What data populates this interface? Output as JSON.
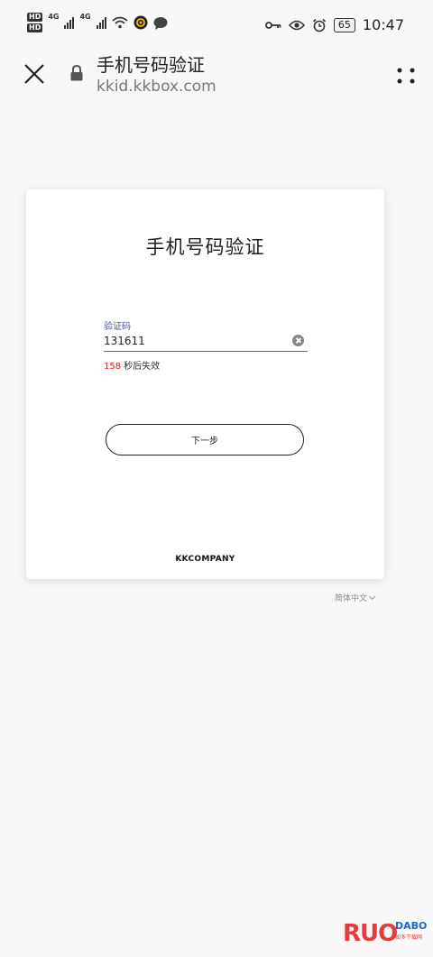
{
  "status_bar": {
    "network_tags": [
      "HD",
      "HD"
    ],
    "signal_labels": [
      "4G",
      "4G"
    ],
    "battery": "65",
    "time": "10:47",
    "icons": [
      "signal-icon",
      "wifi-icon",
      "accessibility-icon",
      "chat-icon",
      "key-icon",
      "eye-icon",
      "alarm-icon",
      "battery-icon"
    ]
  },
  "browser": {
    "title": "手机号码验证",
    "url": "kkid.kkbox.com",
    "icons": [
      "close-icon",
      "lock-icon",
      "more-icon"
    ]
  },
  "card": {
    "title": "手机号码验证",
    "field_label": "验证码",
    "code_value": "131611",
    "expire_seconds": "158",
    "expire_text": "秒后失效",
    "next_button": "下一步",
    "brand": "KKCOMPANY"
  },
  "language": {
    "selected": "简体中文"
  },
  "watermark": {
    "big": "RUO",
    "big_accent": "DABO",
    "small": "如多下载网"
  },
  "colors": {
    "accent": "#4a4fa8",
    "countdown": "#c62828",
    "background": "#f8f8f9"
  }
}
